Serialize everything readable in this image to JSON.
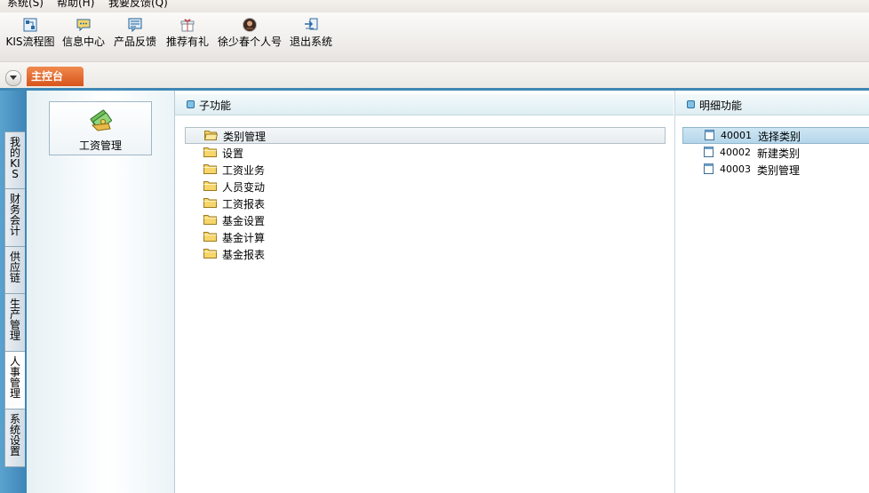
{
  "menubar": {
    "items": [
      "系统(S)",
      "帮助(H)",
      "我要反馈(Q)"
    ]
  },
  "toolbar": {
    "buttons": [
      {
        "label": "KIS流程图",
        "icon": "flowchart-icon"
      },
      {
        "label": "信息中心",
        "icon": "message-icon"
      },
      {
        "label": "产品反馈",
        "icon": "feedback-icon"
      },
      {
        "label": "推荐有礼",
        "icon": "gift-icon"
      },
      {
        "label": "徐少春个人号",
        "icon": "profile-icon"
      },
      {
        "label": "退出系统",
        "icon": "exit-icon"
      }
    ]
  },
  "tabs": {
    "main": "主控台"
  },
  "side_nav": {
    "items": [
      "我的KIS",
      "财务会计",
      "供应链",
      "生产管理",
      "人事管理",
      "系统设置"
    ],
    "active_index": 4
  },
  "module": {
    "label": "工资管理",
    "icon": "payroll-icon"
  },
  "sub_functions": {
    "title": "子功能",
    "items": [
      "类别管理",
      "设置",
      "工资业务",
      "人员变动",
      "工资报表",
      "基金设置",
      "基金计算",
      "基金报表"
    ],
    "selected_index": 0
  },
  "detail_functions": {
    "title": "明细功能",
    "items": [
      {
        "code": "40001",
        "name": "选择类别"
      },
      {
        "code": "40002",
        "name": "新建类别"
      },
      {
        "code": "40003",
        "name": "类别管理"
      }
    ],
    "selected_index": 0
  },
  "colors": {
    "accent_blue": "#3f88b5",
    "main_tab_orange": "#e06a2c",
    "folder_yellow": "#f6d66b"
  }
}
